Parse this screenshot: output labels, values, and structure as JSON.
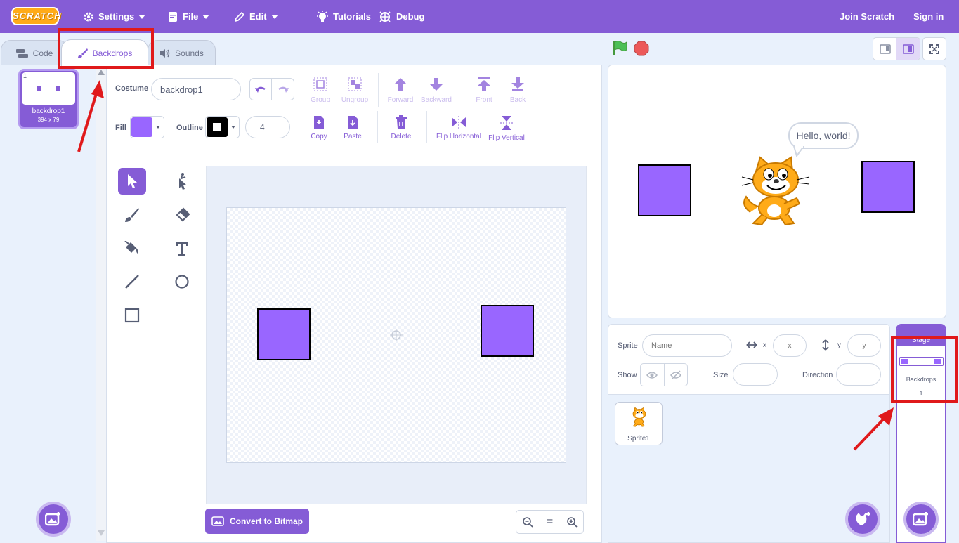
{
  "colors": {
    "accent": "#855cd6",
    "fill": "#9966ff",
    "highlight": "#e0191b"
  },
  "menubar": {
    "logo": "SCRATCH",
    "settings": "Settings",
    "file": "File",
    "edit": "Edit",
    "tutorials": "Tutorials",
    "debug": "Debug",
    "join": "Join Scratch",
    "signin": "Sign in"
  },
  "tabs": {
    "code": "Code",
    "backdrops": "Backdrops",
    "sounds": "Sounds"
  },
  "costume_list": {
    "items": [
      {
        "index": "1",
        "name": "backdrop1",
        "size": "394 x 79"
      }
    ]
  },
  "editor": {
    "costume_label": "Costume",
    "costume_name": "backdrop1",
    "fill_label": "Fill",
    "outline_label": "Outline",
    "outline_width": "4",
    "tools": {
      "group": "Group",
      "ungroup": "Ungroup",
      "forward": "Forward",
      "backward": "Backward",
      "front": "Front",
      "back": "Back",
      "copy": "Copy",
      "paste": "Paste",
      "delete": "Delete",
      "flip_h": "Flip Horizontal",
      "flip_v": "Flip Vertical"
    },
    "convert": "Convert to Bitmap",
    "zoom_reset": "="
  },
  "stage": {
    "speech": "Hello, world!"
  },
  "sprite_info": {
    "sprite_label": "Sprite",
    "name_placeholder": "Name",
    "x_label": "x",
    "x_placeholder": "x",
    "y_label": "y",
    "y_placeholder": "y",
    "show_label": "Show",
    "size_label": "Size",
    "direction_label": "Direction"
  },
  "sprites": [
    {
      "name": "Sprite1"
    }
  ],
  "stage_target": {
    "title": "Stage",
    "backdrops_label": "Backdrops",
    "backdrops_count": "1"
  }
}
